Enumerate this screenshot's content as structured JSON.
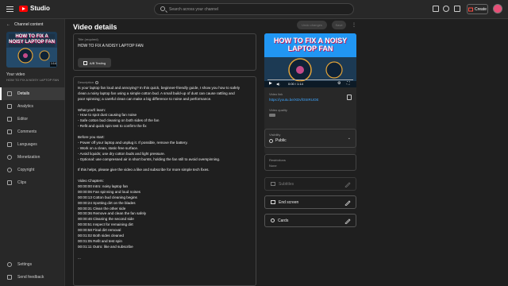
{
  "app": {
    "logo_text": "Studio"
  },
  "search": {
    "placeholder": "Search across your channel"
  },
  "topbar": {
    "create_label": "Create"
  },
  "sidebar": {
    "channel_label": "Channel content",
    "thumb_title": "HOW TO FIX A NOISY LAPTOP FAN",
    "thumb_duration": "1:14",
    "your_video": "Your video",
    "video_title": "HOW TO FIX A NOISY LAPTOP FAN",
    "items": [
      {
        "label": "Details",
        "icon": "pencil-icon",
        "active": true
      },
      {
        "label": "Analytics",
        "icon": "analytics-icon",
        "active": false
      },
      {
        "label": "Editor",
        "icon": "editor-icon",
        "active": false
      },
      {
        "label": "Comments",
        "icon": "comments-icon",
        "active": false
      },
      {
        "label": "Languages",
        "icon": "languages-icon",
        "active": false
      },
      {
        "label": "Monetization",
        "icon": "dollar-icon",
        "active": false
      },
      {
        "label": "Copyright",
        "icon": "copyright-icon",
        "active": false
      },
      {
        "label": "Clips",
        "icon": "clips-icon",
        "active": false
      }
    ],
    "bottom_items": [
      {
        "label": "Settings",
        "icon": "gear-icon"
      },
      {
        "label": "Send feedback",
        "icon": "feedback-icon"
      }
    ]
  },
  "main": {
    "page_title": "Video details",
    "undo_label": "Undo changes",
    "save_label": "Save",
    "title_field": {
      "label": "Title (required)",
      "value": "HOW TO FIX A NOISY LAPTOP FAN"
    },
    "ab_testing_label": "A/B Testing",
    "description": {
      "label": "Description",
      "lines": [
        "Is your laptop fan loud and annoying? In this quick, beginner-friendly guide, I show you how to safely",
        "clean a noisy laptop fan using a simple cotton bud. A small build-up of dust can cause rattling and",
        "poor spinning; a careful clean can make a big difference to noise and performance.",
        "",
        "What you'll learn:",
        "- How to spot dust causing fan noise",
        "- Safe cotton bud cleaning on both sides of the fan",
        "- Refit and quick spin test to confirm the fix",
        "",
        "Before you start:",
        "- Power off your laptop and unplug it. If possible, remove the battery.",
        "- Work on a clean, static-free surface.",
        "- Avoid liquids; use dry cotton buds and light pressure.",
        "- Optional: use compressed air in short bursts, holding the fan still to avoid overspinning.",
        "",
        "If this helps, please give the video a like and subscribe for more simple tech fixes.",
        "",
        "Video Chapters:",
        "00:00:00 Intro: noisy laptop fan",
        "00:00:06 Fan spinning and loud noises",
        "00:00:13 Cotton bud cleaning begins",
        "00:00:24 Spotting dirt on the blades",
        "00:00:31 Clean the other side",
        "00:00:36 Remove and clean the fan safely",
        "00:00:46 Cleaning the second side",
        "00:00:51 Inspect for remaining dirt",
        "00:00:58 Final dirt removal",
        "00:01:02 Both sides cleaned",
        "00:01:05 Refit and test spin",
        "00:01:11 Outro: like and subscribe",
        "",
        "..."
      ]
    }
  },
  "preview": {
    "thumb_title": "HOW TO FIX A NOISY LAPTOP FAN",
    "time": "0:00 / 1:14",
    "video_link_label": "Video link",
    "video_link": "https://youtu.be/XDvfOSIRUOE",
    "video_quality_label": "Video quality"
  },
  "visibility": {
    "label": "Visibility",
    "value": "Public"
  },
  "restrictions": {
    "label": "Restrictions",
    "value": "None"
  },
  "subtitles_label": "Subtitles",
  "end_screen_label": "End screen",
  "cards_label": "Cards",
  "colors": {
    "accent_link": "#3ea6ff",
    "brand_red": "#ff0000",
    "thumb_blue": "#2196f3"
  }
}
